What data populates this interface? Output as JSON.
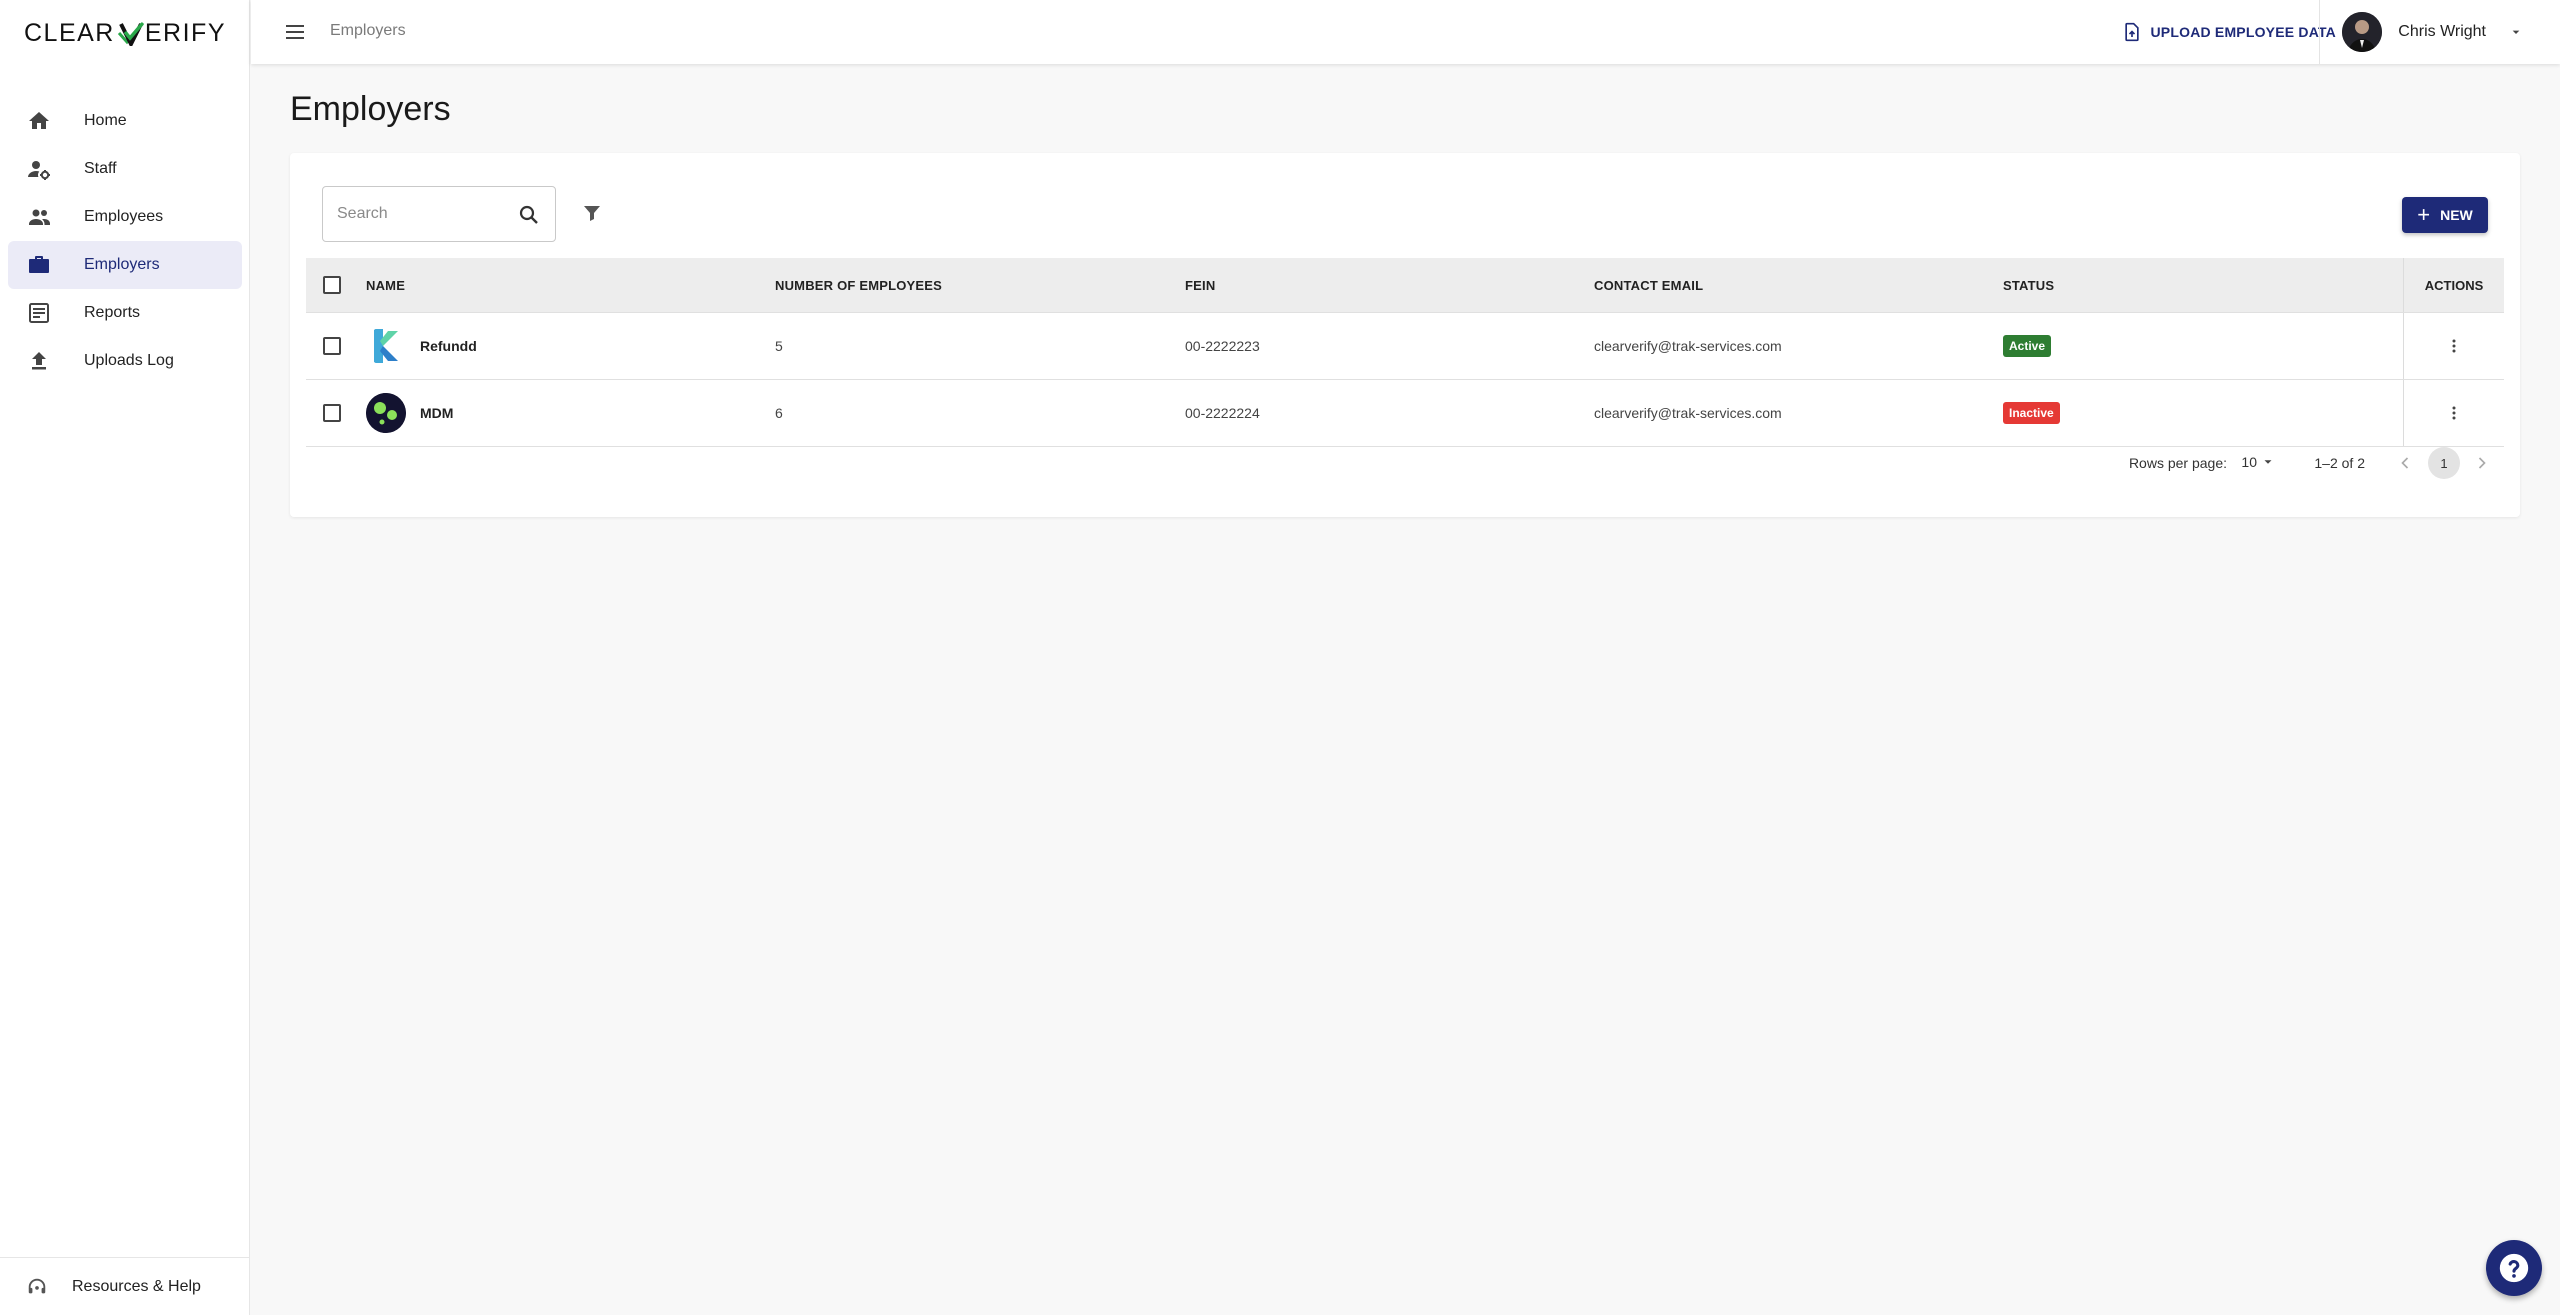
{
  "app": {
    "logo_left": "CLEAR",
    "logo_right": "ERIFY"
  },
  "sidebar": {
    "items": [
      {
        "label": "Home",
        "icon": "home-icon"
      },
      {
        "label": "Staff",
        "icon": "staff-gear-icon"
      },
      {
        "label": "Employees",
        "icon": "people-icon"
      },
      {
        "label": "Employers",
        "icon": "briefcase-icon",
        "active": true
      },
      {
        "label": "Reports",
        "icon": "report-icon"
      },
      {
        "label": "Uploads Log",
        "icon": "upload-icon"
      }
    ],
    "footer_label": "Resources & Help"
  },
  "topbar": {
    "breadcrumb": "Employers",
    "upload_label": "UPLOAD EMPLOYEE DATA",
    "user_name": "Chris Wright"
  },
  "main": {
    "title": "Employers",
    "search_placeholder": "Search",
    "new_label": "NEW",
    "table": {
      "headers": {
        "name": "NAME",
        "num": "NUMBER OF EMPLOYEES",
        "fein": "FEIN",
        "email": "CONTACT EMAIL",
        "status": "STATUS",
        "actions": "ACTIONS"
      },
      "rows": [
        {
          "name": "Refundd",
          "num": "5",
          "fein": "00-2222223",
          "email": "clearverify@trak-services.com",
          "status": "Active",
          "status_color": "#2e7d32"
        },
        {
          "name": "MDM",
          "num": "6",
          "fein": "00-2222224",
          "email": "clearverify@trak-services.com",
          "status": "Inactive",
          "status_color": "#e53935"
        }
      ]
    },
    "pagination": {
      "rows_label": "Rows per page:",
      "rows_value": "10",
      "range": "1–2 of 2",
      "current_page": "1"
    }
  },
  "colors": {
    "accent": "#1e2a78",
    "active_nav_bg": "#ebebf7",
    "active_badge": "#2e7d32",
    "inactive_badge": "#e53935"
  }
}
